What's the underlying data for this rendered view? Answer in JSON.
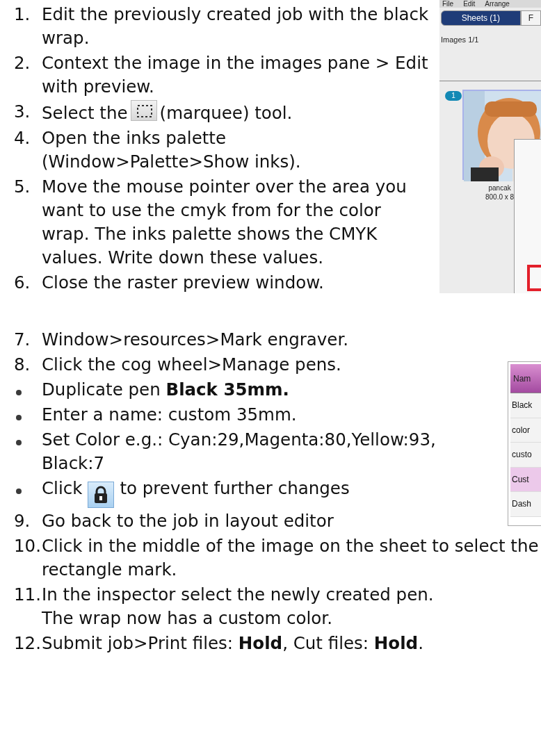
{
  "sections": [
    {
      "screenshot": {
        "kind": "sheets-panel",
        "menu": [
          "File",
          "Edit",
          "Arrange"
        ],
        "tabs": [
          {
            "label": "Sheets (1)",
            "selected": true
          },
          {
            "label": "F",
            "selected": false
          }
        ],
        "images_count": "Images 1/1",
        "thumbnail": {
          "badge": "1",
          "name": "pancak",
          "size": "800.0 x 8",
          "selected": true
        }
      },
      "items": [
        {
          "kind": "number",
          "marker": "1.",
          "text": "Edit the previously created job with the black wrap."
        },
        {
          "kind": "number",
          "marker": "2.",
          "text": "Context the image in the images pane > Edit with preview."
        },
        {
          "kind": "number-marquee",
          "marker": "3.",
          "text": "Select the",
          "text_after": "(marquee) tool."
        },
        {
          "kind": "number",
          "marker": "4.",
          "text": "Open the inks palette",
          "continuation": "(Window>Palette>Show inks)."
        },
        {
          "kind": "number",
          "marker": "5.",
          "text": "Move the mouse pointer over the area you want to use the cmyk from for the color wrap. The inks palette shows the CMYK values. Write down these values."
        },
        {
          "kind": "number",
          "marker": "6.",
          "text": "Close the raster preview window."
        }
      ]
    },
    {
      "screenshot": {
        "kind": "pen-table",
        "header": "Nam",
        "rows": [
          {
            "label": "Black",
            "selected": false
          },
          {
            "label": "color",
            "selected": false
          },
          {
            "label": "custo",
            "selected": false
          },
          {
            "label": "Cust",
            "selected": true
          },
          {
            "label": "Dash",
            "selected": false
          }
        ]
      },
      "items": [
        {
          "kind": "number",
          "marker": "7.",
          "text": "Window>resources>Mark engraver."
        },
        {
          "kind": "number",
          "marker": "8.",
          "text": "Click the cog wheel>Manage pens."
        },
        {
          "kind": "bullet",
          "text": "Duplicate pen **Black 35mm.**"
        },
        {
          "kind": "bullet",
          "text": "Enter a name: custom 35mm."
        },
        {
          "kind": "bullet",
          "text": "Set Color e.g.: Cyan:29,Magenta:80,Yellow:93, Black:7"
        },
        {
          "kind": "bullet-lock",
          "text": "Click",
          "text_after": "to prevent further changes"
        },
        {
          "kind": "number",
          "marker": "9.",
          "text": "Go back to the job in layout editor"
        },
        {
          "kind": "number",
          "marker": "10.",
          "text": "Click in the middle of the image on the sheet to select the rectangle mark."
        },
        {
          "kind": "number",
          "marker": "11.",
          "text": "In the inspector select the newly created pen.",
          "continuation": "The wrap now has a custom color."
        },
        {
          "kind": "number",
          "marker": "12.",
          "text": "Submit job>Print files: **Hold**, Cut files: **Hold**."
        }
      ]
    }
  ]
}
